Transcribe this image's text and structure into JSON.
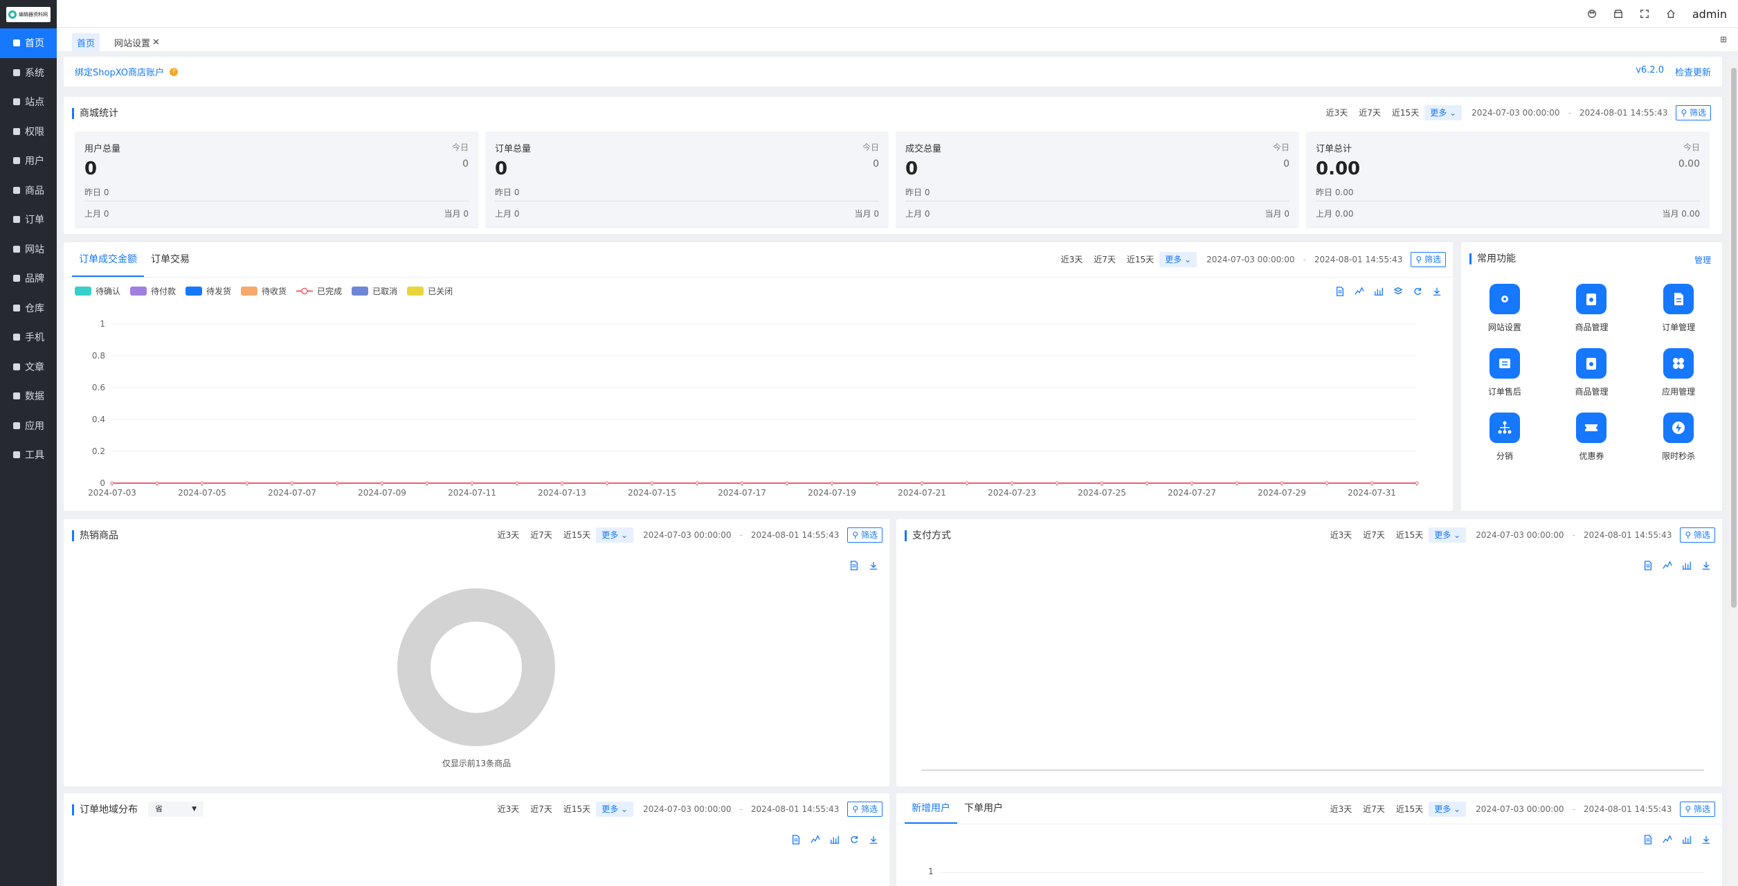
{
  "app": {
    "logo_text": "编辑器资料网",
    "admin": "admin",
    "version": "v6.2.0",
    "check_update": "检查更新"
  },
  "sidebar": [
    {
      "label": "首页",
      "icon": "home-icon"
    },
    {
      "label": "系统",
      "icon": "gear-icon"
    },
    {
      "label": "站点",
      "icon": "sliders-icon"
    },
    {
      "label": "权限",
      "icon": "lock-user-icon"
    },
    {
      "label": "用户",
      "icon": "user-icon"
    },
    {
      "label": "商品",
      "icon": "box-icon"
    },
    {
      "label": "订单",
      "icon": "order-icon"
    },
    {
      "label": "网站",
      "icon": "site-icon"
    },
    {
      "label": "品牌",
      "icon": "brand-icon"
    },
    {
      "label": "仓库",
      "icon": "warehouse-icon"
    },
    {
      "label": "手机",
      "icon": "phone-icon"
    },
    {
      "label": "文章",
      "icon": "article-icon"
    },
    {
      "label": "数据",
      "icon": "chart-icon"
    },
    {
      "label": "应用",
      "icon": "apps-icon"
    },
    {
      "label": "工具",
      "icon": "wrench-icon"
    }
  ],
  "tabs": [
    {
      "label": "首页"
    },
    {
      "label": "网站设置"
    }
  ],
  "tab_close": "✕",
  "bind_link": "绑定ShopXO商店账户",
  "filters": {
    "d3": "近3天",
    "d7": "近7天",
    "d15": "近15天",
    "more": "更多",
    "start": "2024-07-03 00:00:00",
    "sep": "-",
    "end": "2024-08-01 14:55:43",
    "btn": "筛选"
  },
  "stats": {
    "title": "商城统计",
    "cards": [
      {
        "title": "用户总量",
        "total": "0",
        "today_label": "今日",
        "today": "0",
        "yesterday": "昨日  0",
        "last_month": "上月  0",
        "this_month": "当月  0"
      },
      {
        "title": "订单总量",
        "total": "0",
        "today_label": "今日",
        "today": "0",
        "yesterday": "昨日 0",
        "last_month": "上月  0",
        "this_month": "当月  0"
      },
      {
        "title": "成交总量",
        "total": "0",
        "today_label": "今日",
        "today": "0",
        "yesterday": "昨日 0",
        "last_month": "上月  0",
        "this_month": "当月  0"
      },
      {
        "title": "订单总计",
        "total": "0.00",
        "today_label": "今日",
        "today": "0.00",
        "yesterday": "昨日 0.00",
        "last_month": "上月  0.00",
        "this_month": "当月  0.00"
      }
    ]
  },
  "order_chart": {
    "tabs": [
      "订单成交金额",
      "订单交易"
    ],
    "legend": [
      {
        "name": "待确认",
        "color": "#36cfc9"
      },
      {
        "name": "待付款",
        "color": "#9f7fe0"
      },
      {
        "name": "待发货",
        "color": "#1677ff"
      },
      {
        "name": "待收货",
        "color": "#f7a86b"
      },
      {
        "name": "已完成",
        "color": "#f0606b"
      },
      {
        "name": "已取消",
        "color": "#6f86d6"
      },
      {
        "name": "已关闭",
        "color": "#e8d53c"
      }
    ]
  },
  "chart_data": [
    {
      "type": "line",
      "title": "订单成交金额",
      "x": [
        "2024-07-03",
        "2024-07-04",
        "2024-07-05",
        "2024-07-06",
        "2024-07-07",
        "2024-07-08",
        "2024-07-09",
        "2024-07-10",
        "2024-07-11",
        "2024-07-12",
        "2024-07-13",
        "2024-07-14",
        "2024-07-15",
        "2024-07-16",
        "2024-07-17",
        "2024-07-18",
        "2024-07-19",
        "2024-07-20",
        "2024-07-21",
        "2024-07-22",
        "2024-07-23",
        "2024-07-24",
        "2024-07-25",
        "2024-07-26",
        "2024-07-27",
        "2024-07-28",
        "2024-07-29",
        "2024-07-30",
        "2024-07-31",
        "2024-08-01"
      ],
      "xtick_labels": [
        "2024-07-03",
        "2024-07-05",
        "2024-07-07",
        "2024-07-09",
        "2024-07-11",
        "2024-07-13",
        "2024-07-15",
        "2024-07-17",
        "2024-07-19",
        "2024-07-21",
        "2024-07-23",
        "2024-07-25",
        "2024-07-27",
        "2024-07-29",
        "2024-07-31"
      ],
      "yticks": [
        "0",
        "0.2",
        "0.4",
        "0.6",
        "0.8",
        "1"
      ],
      "ylim": [
        0,
        1
      ],
      "series": [
        {
          "name": "已完成",
          "values": [
            0,
            0,
            0,
            0,
            0,
            0,
            0,
            0,
            0,
            0,
            0,
            0,
            0,
            0,
            0,
            0,
            0,
            0,
            0,
            0,
            0,
            0,
            0,
            0,
            0,
            0,
            0,
            0,
            0,
            0
          ]
        }
      ],
      "legend": "top-left",
      "grid": true
    },
    {
      "type": "pie",
      "title": "热销商品",
      "note": "仅显示前13条商品",
      "values": []
    }
  ],
  "quick": {
    "title": "常用功能",
    "manage": "管理",
    "items": [
      {
        "label": "网站设置",
        "icon": "site-settings-icon"
      },
      {
        "label": "商品管理",
        "icon": "goods-manage-icon"
      },
      {
        "label": "订单管理",
        "icon": "order-manage-icon"
      },
      {
        "label": "订单售后",
        "icon": "aftersale-icon"
      },
      {
        "label": "商品管理",
        "icon": "goods-manage-icon"
      },
      {
        "label": "应用管理",
        "icon": "app-manage-icon"
      },
      {
        "label": "分销",
        "icon": "distribution-icon"
      },
      {
        "label": "优惠券",
        "icon": "coupon-icon"
      },
      {
        "label": "限时秒杀",
        "icon": "flash-sale-icon"
      }
    ]
  },
  "hot": {
    "title": "热销商品",
    "note": "仅显示前13条商品"
  },
  "pay": {
    "title": "支付方式"
  },
  "region": {
    "title": "订单地域分布",
    "select": "省"
  },
  "users": {
    "tabs": [
      "新增用户",
      "下单用户"
    ],
    "ytop": "1"
  }
}
